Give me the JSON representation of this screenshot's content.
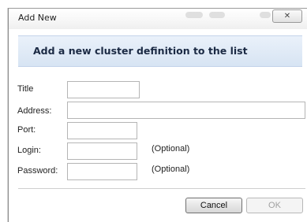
{
  "window": {
    "title": "Add New",
    "close_glyph": "✕"
  },
  "header": {
    "text": "Add a new cluster definition to the list"
  },
  "form": {
    "title_label": "Title",
    "address_label": "Address:",
    "port_label": "Port:",
    "login_label": "Login:",
    "password_label": "Password:",
    "login_hint": "(Optional)",
    "password_hint": "(Optional)",
    "title_value": "",
    "address_value": "",
    "port_value": "",
    "login_value": "",
    "password_value": ""
  },
  "buttons": {
    "cancel_label": "Cancel",
    "ok_label": "OK"
  },
  "colors": {
    "header_band": "#d7e4f3",
    "header_text": "#1b2a44"
  }
}
